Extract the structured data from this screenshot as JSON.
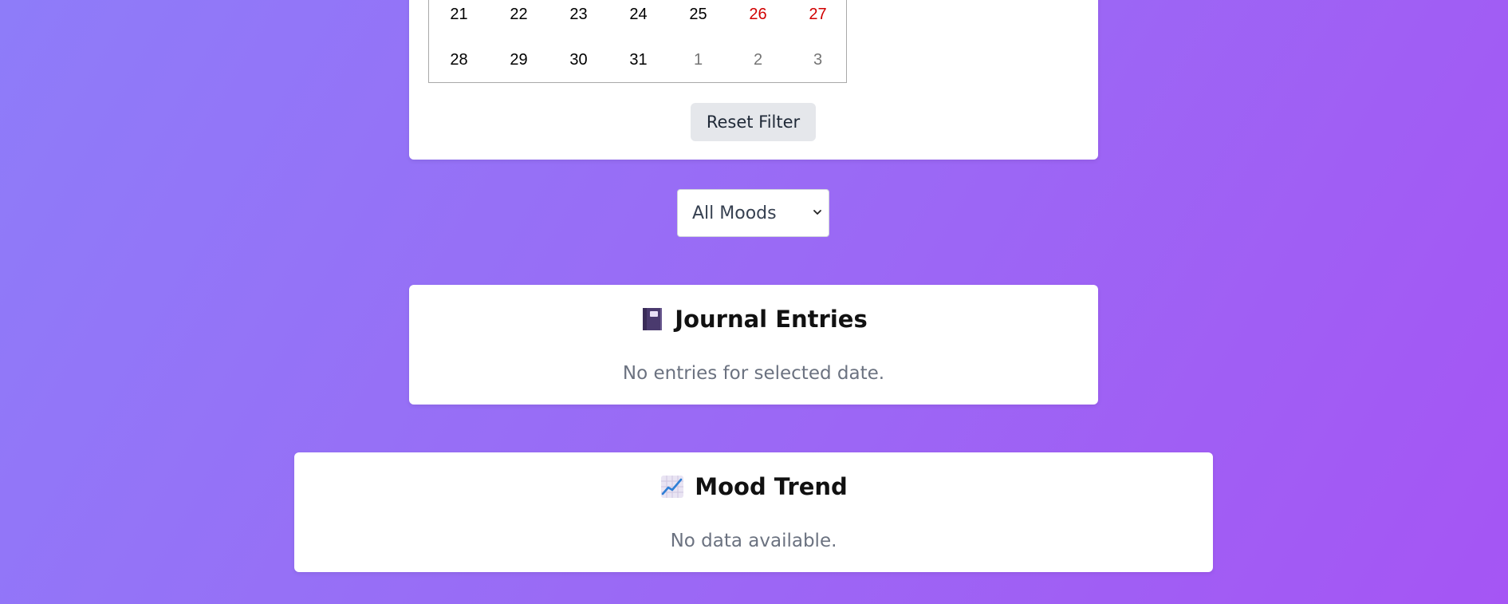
{
  "calendar": {
    "rows": [
      [
        {
          "day": "21",
          "kind": "normal"
        },
        {
          "day": "22",
          "kind": "normal"
        },
        {
          "day": "23",
          "kind": "normal"
        },
        {
          "day": "24",
          "kind": "normal"
        },
        {
          "day": "25",
          "kind": "normal"
        },
        {
          "day": "26",
          "kind": "weekend"
        },
        {
          "day": "27",
          "kind": "weekend"
        }
      ],
      [
        {
          "day": "28",
          "kind": "normal"
        },
        {
          "day": "29",
          "kind": "normal"
        },
        {
          "day": "30",
          "kind": "normal"
        },
        {
          "day": "31",
          "kind": "normal"
        },
        {
          "day": "1",
          "kind": "other"
        },
        {
          "day": "2",
          "kind": "other"
        },
        {
          "day": "3",
          "kind": "other"
        }
      ]
    ],
    "weekend_color": "#d10000",
    "other_month_color": "#757575"
  },
  "filter": {
    "reset_label": "Reset Filter"
  },
  "mood_select": {
    "selected": "All Moods",
    "icon": "chevron-down-icon"
  },
  "journal": {
    "title": "Journal Entries",
    "icon": "notebook-icon",
    "empty_text": "No entries for selected date."
  },
  "trend": {
    "title": "Mood Trend",
    "icon": "chart-increasing-icon",
    "empty_text": "No data available."
  },
  "colors": {
    "background_start": "#8e7cf9",
    "background_end": "#a555f4",
    "card": "#ffffff",
    "button_bg": "#e5e7eb"
  }
}
